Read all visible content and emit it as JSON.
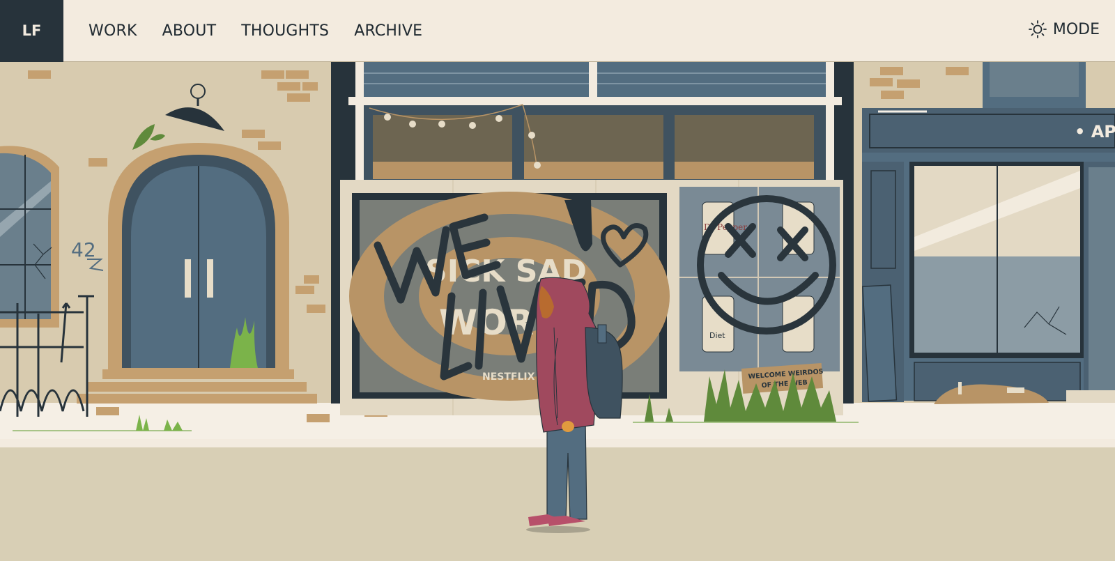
{
  "nav": {
    "logo": "LF",
    "links": [
      "WORK",
      "ABOUT",
      "THOUGHTS",
      "ARCHIVE"
    ],
    "mode_label": "MODE",
    "mode_icon": "sun-icon"
  },
  "scene": {
    "house_number": "42",
    "poster_title_line1": "SICK SAD",
    "poster_title_line2": "WORLD",
    "poster_brand": "NESTFLIX",
    "graffiti_line1": "WE",
    "graffiti_line2": "LIVED",
    "can_brand": "Dr Pepper",
    "can_label": "Diet",
    "sign_line1": "WELCOME WEIRDOS",
    "sign_line2": "OF THE WEB",
    "shop_sign": "• AP"
  },
  "colors": {
    "nav_bg": "#f3ebdf",
    "logo_bg": "#27333b",
    "wall": "#d8cbaf",
    "sidewalk": "#f3ebdf",
    "street": "#d8cfb5",
    "navy": "#27333b",
    "slate": "#4e6577",
    "tan": "#b89466",
    "hoodie": "#a0495e",
    "grass": "#5f8a3b"
  }
}
